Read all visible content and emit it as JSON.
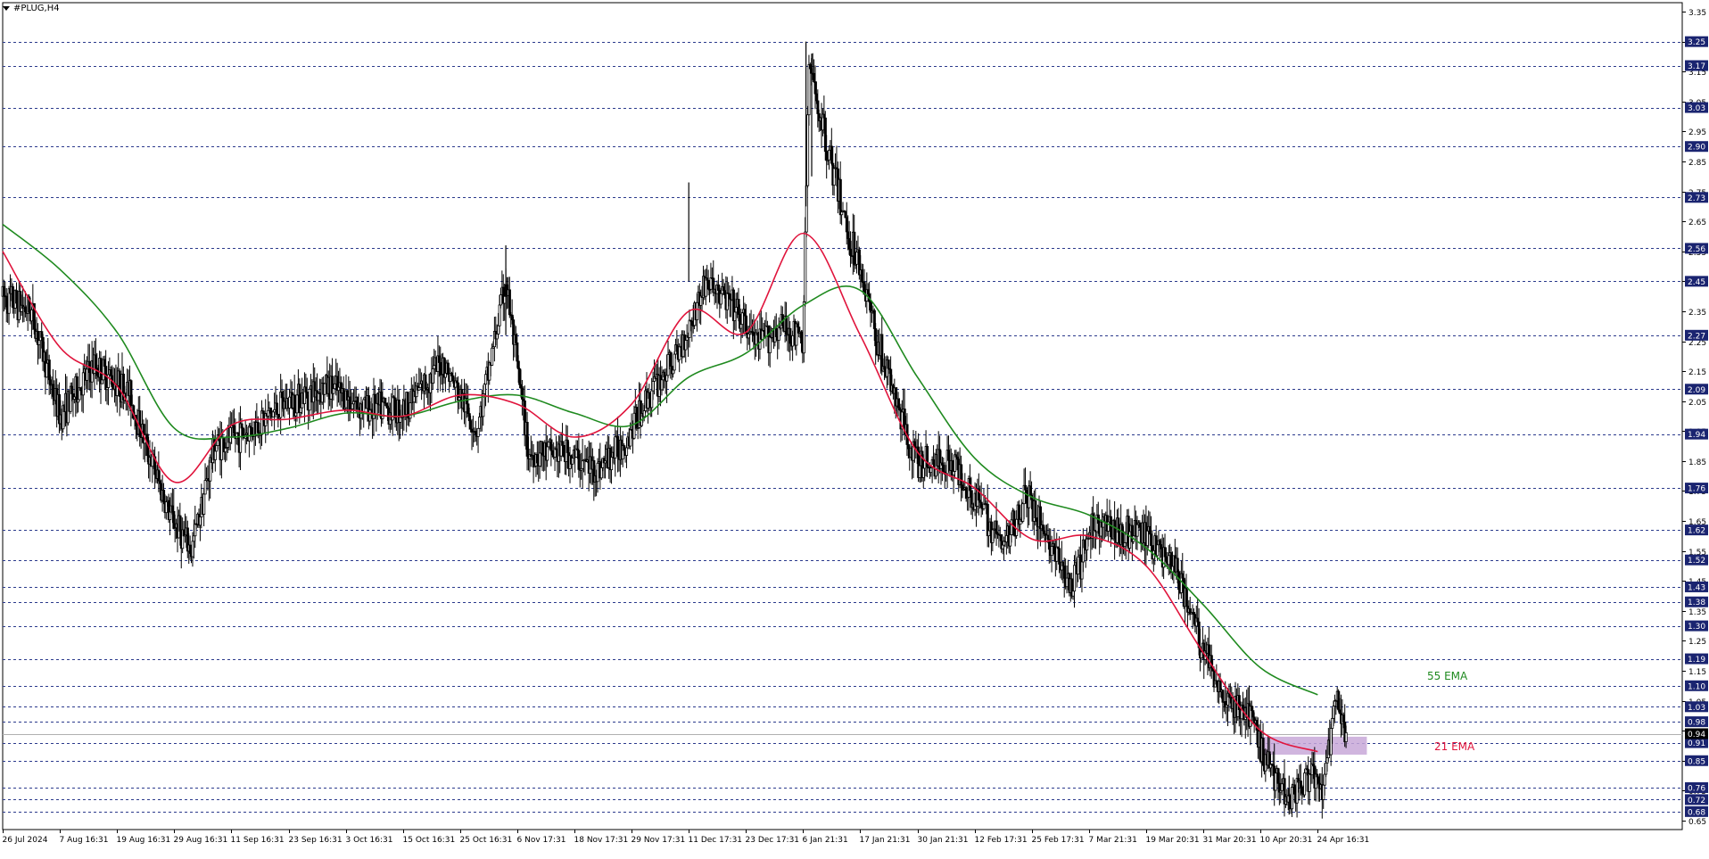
{
  "window": {
    "symbol_label": "#PLUG,H4"
  },
  "colors": {
    "background": "#ffffff",
    "candle": "#000000",
    "grid_line": "#2b3a8c",
    "price_badge_bg": "#1a2470",
    "price_badge_text": "#ffffff",
    "ema21": "#e0143c",
    "ema55": "#1f8a1f",
    "zone_fill": "#c8a8d8",
    "current_price_bg": "#000000"
  },
  "chart_data": {
    "type": "candlestick",
    "symbol": "#PLUG",
    "timeframe": "H4",
    "ylim": [
      0.62,
      3.38
    ],
    "y_ticks": [
      0.65,
      0.75,
      0.85,
      0.95,
      1.05,
      1.15,
      1.25,
      1.35,
      1.45,
      1.55,
      1.65,
      1.75,
      1.85,
      1.95,
      2.05,
      2.15,
      2.25,
      2.35,
      2.45,
      2.55,
      2.65,
      2.75,
      2.85,
      2.95,
      3.05,
      3.15,
      3.25,
      3.35
    ],
    "y_tick_labels": [
      "0.65",
      "0.75",
      "0.85",
      "0.95",
      "1.05",
      "1.15",
      "1.25",
      "1.35",
      "1.45",
      "1.55",
      "1.65",
      "1.75",
      "1.85",
      "1.95",
      "2.05",
      "2.15",
      "2.25",
      "2.35",
      "2.45",
      "2.55",
      "2.65",
      "2.75",
      "2.85",
      "2.95",
      "3.05",
      "3.15",
      "3.25",
      "3.35"
    ],
    "x_tick_labels": [
      "26 Jul 2024",
      "7 Aug 16:31",
      "19 Aug 16:31",
      "29 Aug 16:31",
      "11 Sep 16:31",
      "23 Sep 16:31",
      "3 Oct 16:31",
      "15 Oct 16:31",
      "25 Oct 16:31",
      "6 Nov 17:31",
      "18 Nov 17:31",
      "29 Nov 17:31",
      "11 Dec 17:31",
      "23 Dec 17:31",
      "6 Jan 21:31",
      "17 Jan 21:31",
      "30 Jan 21:31",
      "12 Feb 17:31",
      "25 Feb 17:31",
      "7 Mar 21:31",
      "19 Mar 20:31",
      "31 Mar 20:31",
      "10 Apr 20:31",
      "24 Apr 16:31"
    ],
    "horizontal_levels": [
      {
        "value": 3.25,
        "label": "3.25"
      },
      {
        "value": 3.17,
        "label": "3.17"
      },
      {
        "value": 3.03,
        "label": "3.03"
      },
      {
        "value": 2.9,
        "label": "2.90"
      },
      {
        "value": 2.73,
        "label": "2.73"
      },
      {
        "value": 2.56,
        "label": "2.56"
      },
      {
        "value": 2.45,
        "label": "2.45"
      },
      {
        "value": 2.27,
        "label": "2.27"
      },
      {
        "value": 2.09,
        "label": "2.09"
      },
      {
        "value": 1.94,
        "label": "1.94"
      },
      {
        "value": 1.76,
        "label": "1.76"
      },
      {
        "value": 1.62,
        "label": "1.62"
      },
      {
        "value": 1.52,
        "label": "1.52"
      },
      {
        "value": 1.43,
        "label": "1.43"
      },
      {
        "value": 1.38,
        "label": "1.38"
      },
      {
        "value": 1.3,
        "label": "1.30"
      },
      {
        "value": 1.19,
        "label": "1.19"
      },
      {
        "value": 1.1,
        "label": "1.10"
      },
      {
        "value": 1.03,
        "label": "1.03"
      },
      {
        "value": 0.98,
        "label": "0.98"
      },
      {
        "value": 0.91,
        "label": "0.91"
      },
      {
        "value": 0.85,
        "label": "0.85"
      },
      {
        "value": 0.76,
        "label": "0.76"
      },
      {
        "value": 0.72,
        "label": "0.72"
      },
      {
        "value": 0.68,
        "label": "0.68"
      }
    ],
    "current_price": {
      "value": 0.94,
      "label": "0.94"
    },
    "zone": {
      "low": 0.87,
      "high": 0.93,
      "from_date": "10 Apr 20:31",
      "to_date": "24 Apr 16:31"
    },
    "series": [
      {
        "name": "55 EMA",
        "color": "#1f8a1f"
      },
      {
        "name": "21 EMA",
        "color": "#e0143c"
      }
    ],
    "ema_keypoints_by_label": {
      "55 EMA": [
        [
          0,
          2.64
        ],
        [
          1,
          2.49
        ],
        [
          2,
          2.28
        ],
        [
          3,
          1.96
        ],
        [
          4,
          1.93
        ],
        [
          5,
          1.96
        ],
        [
          6,
          2.01
        ],
        [
          7,
          2.0
        ],
        [
          8,
          2.05
        ],
        [
          9,
          2.07
        ],
        [
          10,
          2.01
        ],
        [
          11,
          1.97
        ],
        [
          12,
          2.13
        ],
        [
          13,
          2.21
        ],
        [
          14,
          2.37
        ],
        [
          15,
          2.42
        ],
        [
          16,
          2.13
        ],
        [
          17,
          1.86
        ],
        [
          18,
          1.73
        ],
        [
          19,
          1.67
        ],
        [
          20,
          1.56
        ],
        [
          21,
          1.37
        ],
        [
          22,
          1.16
        ],
        [
          23,
          1.07
        ]
      ],
      "21 EMA": [
        [
          0,
          2.55
        ],
        [
          1,
          2.23
        ],
        [
          2,
          2.1
        ],
        [
          3,
          1.78
        ],
        [
          4,
          1.97
        ],
        [
          5,
          1.99
        ],
        [
          6,
          2.02
        ],
        [
          7,
          2.0
        ],
        [
          8,
          2.07
        ],
        [
          9,
          2.04
        ],
        [
          10,
          1.93
        ],
        [
          11,
          2.04
        ],
        [
          12,
          2.35
        ],
        [
          13,
          2.28
        ],
        [
          14,
          2.61
        ],
        [
          15,
          2.27
        ],
        [
          16,
          1.88
        ],
        [
          17,
          1.76
        ],
        [
          18,
          1.59
        ],
        [
          19,
          1.6
        ],
        [
          20,
          1.5
        ],
        [
          21,
          1.21
        ],
        [
          22,
          0.95
        ],
        [
          23,
          0.88
        ]
      ]
    },
    "price_path_keypoints": [
      [
        0,
        2.4
      ],
      [
        0.5,
        2.35
      ],
      [
        1,
        2.0
      ],
      [
        1.6,
        2.17
      ],
      [
        2.2,
        2.08
      ],
      [
        2.9,
        1.68
      ],
      [
        3.3,
        1.55
      ],
      [
        3.7,
        1.9
      ],
      [
        4.3,
        1.95
      ],
      [
        5.0,
        2.05
      ],
      [
        5.7,
        2.1
      ],
      [
        6.3,
        2.03
      ],
      [
        7,
        2.02
      ],
      [
        7.7,
        2.18
      ],
      [
        8.3,
        1.95
      ],
      [
        8.8,
        2.45
      ],
      [
        9.2,
        1.87
      ],
      [
        9.8,
        1.88
      ],
      [
        10.4,
        1.82
      ],
      [
        10.9,
        1.92
      ],
      [
        11.3,
        2.07
      ],
      [
        11.8,
        2.2
      ],
      [
        12.3,
        2.45
      ],
      [
        12.7,
        2.38
      ],
      [
        13.2,
        2.24
      ],
      [
        13.6,
        2.3
      ],
      [
        14.0,
        2.25
      ],
      [
        14.1,
        3.17
      ],
      [
        14.4,
        2.92
      ],
      [
        14.8,
        2.6
      ],
      [
        15.0,
        2.5
      ],
      [
        15.3,
        2.25
      ],
      [
        15.7,
        2.0
      ],
      [
        16.0,
        1.84
      ],
      [
        16.6,
        1.85
      ],
      [
        17.1,
        1.7
      ],
      [
        17.5,
        1.56
      ],
      [
        17.9,
        1.74
      ],
      [
        18.3,
        1.58
      ],
      [
        18.7,
        1.42
      ],
      [
        19.1,
        1.65
      ],
      [
        19.5,
        1.62
      ],
      [
        20.0,
        1.6
      ],
      [
        20.5,
        1.5
      ],
      [
        21.0,
        1.22
      ],
      [
        21.4,
        1.05
      ],
      [
        21.8,
        1.0
      ],
      [
        22.1,
        0.85
      ],
      [
        22.5,
        0.73
      ],
      [
        22.9,
        0.8
      ],
      [
        23.1,
        0.75
      ],
      [
        23.3,
        1.05
      ],
      [
        23.5,
        0.93
      ]
    ],
    "annotations": [
      {
        "text": "55 EMA",
        "color": "#1f8a1f"
      },
      {
        "text": "21 EMA",
        "color": "#e0143c"
      }
    ]
  }
}
